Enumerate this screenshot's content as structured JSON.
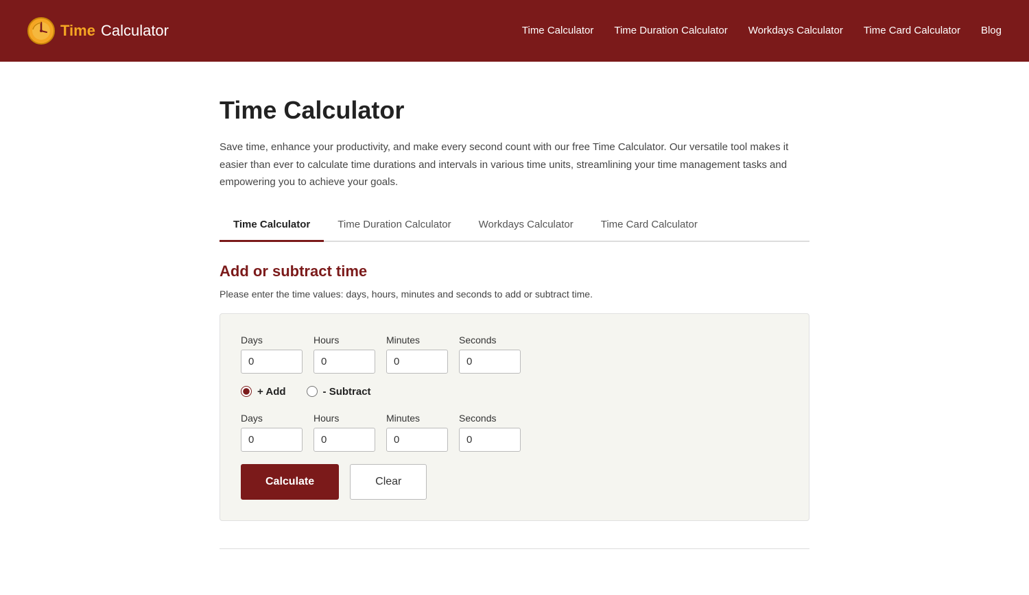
{
  "nav": {
    "logo_time": "Time",
    "logo_calc": " Calculator",
    "links": [
      {
        "label": "Time Calculator",
        "href": "#"
      },
      {
        "label": "Time Duration Calculator",
        "href": "#"
      },
      {
        "label": "Workdays Calculator",
        "href": "#"
      },
      {
        "label": "Time Card Calculator",
        "href": "#"
      },
      {
        "label": "Blog",
        "href": "#"
      }
    ]
  },
  "page": {
    "title": "Time Calculator",
    "description": "Save time, enhance your productivity, and make every second count with our free Time Calculator. Our versatile tool makes it easier than ever to calculate time durations and intervals in various time units, streamlining your time management tasks and empowering you to achieve your goals."
  },
  "tabs": [
    {
      "label": "Time Calculator",
      "active": true
    },
    {
      "label": "Time Duration Calculator",
      "active": false
    },
    {
      "label": "Workdays Calculator",
      "active": false
    },
    {
      "label": "Time Card Calculator",
      "active": false
    }
  ],
  "calculator": {
    "section_title": "Add or subtract time",
    "section_description": "Please enter the time values: days, hours, minutes and seconds to add or subtract time.",
    "row1": {
      "days_label": "Days",
      "hours_label": "Hours",
      "minutes_label": "Minutes",
      "seconds_label": "Seconds",
      "days_value": "0",
      "hours_value": "0",
      "minutes_value": "0",
      "seconds_value": "0"
    },
    "radio_add_label": "+ Add",
    "radio_sub_label": "- Subtract",
    "row2": {
      "days_label": "Days",
      "hours_label": "Hours",
      "minutes_label": "Minutes",
      "seconds_label": "Seconds",
      "days_value": "0",
      "hours_value": "0",
      "minutes_value": "0",
      "seconds_value": "0"
    },
    "calculate_label": "Calculate",
    "clear_label": "Clear"
  }
}
